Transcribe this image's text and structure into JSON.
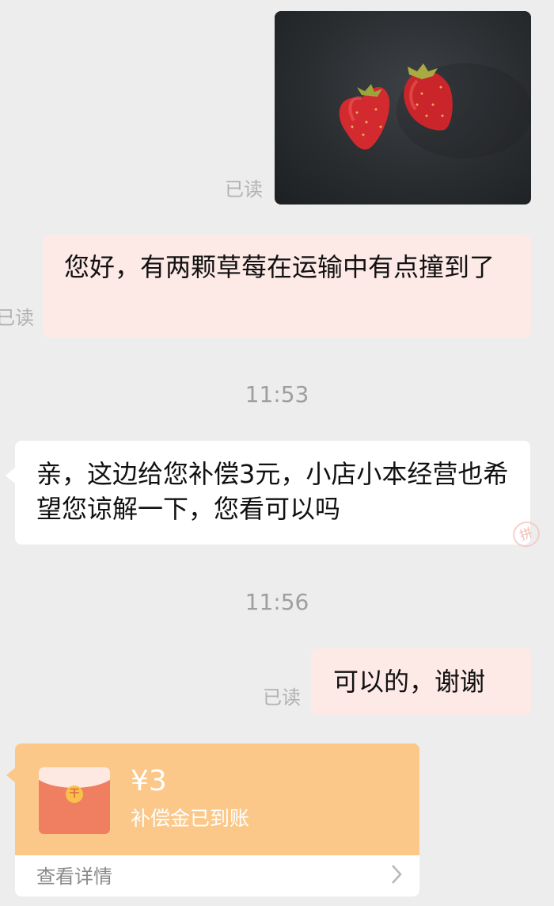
{
  "messages": [
    {
      "type": "image",
      "side": "right",
      "read_status": "已读",
      "image_icon": "strawberry-photo"
    },
    {
      "type": "text",
      "side": "right",
      "text": "您好，有两颗草莓在运输中有点撞到了",
      "read_status": "已读"
    },
    {
      "type": "timestamp",
      "text": "11:53"
    },
    {
      "type": "text",
      "side": "left",
      "text": "亲，这边给您补偿3元，小店小本经营也希望您谅解一下，您看可以吗"
    },
    {
      "type": "timestamp",
      "text": "11:56"
    },
    {
      "type": "text",
      "side": "right",
      "text": "可以的，谢谢",
      "read_status": "已读"
    }
  ],
  "red_packet": {
    "amount": "¥3",
    "status": "补偿金已到账",
    "link_label": "查看详情",
    "seal_glyph": "干",
    "icon": "red-envelope-icon"
  },
  "edge_marks": {
    "left_read_fragment": "已读",
    "right_fragment": "拼"
  },
  "colors": {
    "background": "#ededed",
    "outgoing_bubble": "#fde9e6",
    "incoming_bubble": "#ffffff",
    "red_packet": "#fbc88a",
    "envelope": "#f07f62"
  }
}
